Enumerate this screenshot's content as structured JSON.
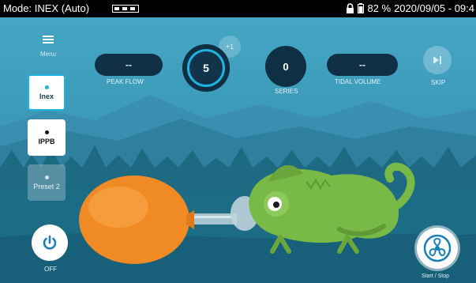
{
  "status": {
    "mode": "Mode: INEX (Auto)",
    "battery": "82 %",
    "datetime": "2020/09/05 - 09:4"
  },
  "sidebar": {
    "menu_label": "Menu",
    "items": [
      {
        "label": "Inex",
        "state": "active"
      },
      {
        "label": "IPPB",
        "state": "normal"
      },
      {
        "label": "Preset 2",
        "state": "disabled"
      }
    ],
    "power_label": "OFF"
  },
  "metrics": {
    "peak_flow": {
      "value": "--",
      "label": "PEAK FLOW"
    },
    "counter": {
      "value": "5",
      "badge": "+1"
    },
    "series": {
      "value": "0",
      "label": "SERIES"
    },
    "tidal_volume": {
      "value": "--",
      "label": "TIDAL VOLUME"
    },
    "skip_label": "SKIP"
  },
  "fan_label": "Start / Stop",
  "colors": {
    "sky": "#3b97b6",
    "pill_dark": "#0f2f44",
    "accent": "#1fb4e0",
    "balloon": "#f08a24",
    "chameleon": "#79b947"
  },
  "icons": {
    "menu": "hamburger-icon",
    "power": "power-icon",
    "skip": "skip-next-icon",
    "fan": "fan-icon",
    "lock": "lock-icon",
    "battery": "battery-icon"
  }
}
